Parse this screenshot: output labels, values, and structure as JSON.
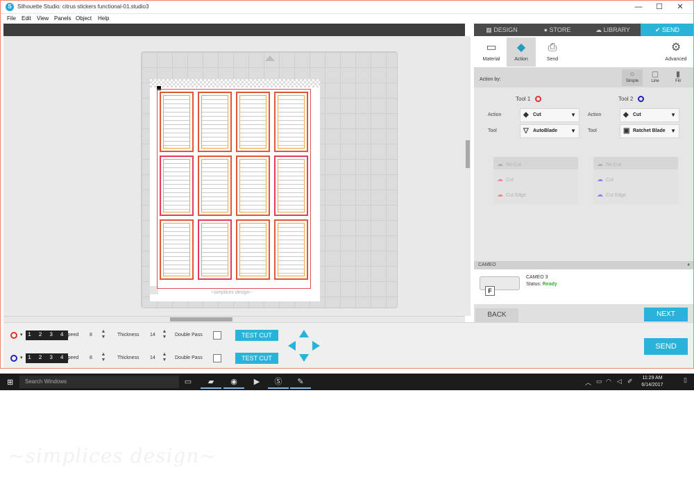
{
  "window": {
    "title": "Silhouette Studio: citrus stickers functional-01.studio3",
    "app_icon": "S",
    "minimize": "—",
    "maximize": "☐",
    "close": "✕"
  },
  "menu": [
    "File",
    "Edit",
    "View",
    "Panels",
    "Object",
    "Help"
  ],
  "panel_tabs": [
    {
      "label": "DESIGN",
      "icon": "grid-icon"
    },
    {
      "label": "STORE",
      "icon": "store-icon"
    },
    {
      "label": "LIBRARY",
      "icon": "cloud-icon"
    },
    {
      "label": "SEND",
      "icon": "check-circle-icon",
      "active": true
    }
  ],
  "send_tabs": [
    "Material",
    "Action",
    "Send",
    "Advanced"
  ],
  "action_by": {
    "label": "Action by:",
    "modes": [
      "Simple",
      "Line",
      "Fill"
    ]
  },
  "tools": [
    {
      "heading": "Tool 1",
      "ring_color": "#e03030",
      "action_label": "Action",
      "action_value": "Cut",
      "tool_label": "Tool",
      "tool_value": "AutoBlade",
      "options": [
        "No Cut",
        "Cut",
        "Cut Edge"
      ]
    },
    {
      "heading": "Tool 2",
      "ring_color": "#2020c0",
      "action_label": "Action",
      "action_value": "Cut",
      "tool_label": "Tool",
      "tool_value": "Ratchet Blade",
      "options": [
        "No Cut",
        "Cut",
        "Cut Edge"
      ]
    }
  ],
  "cameo": {
    "header": "CAMEO",
    "name": "CAMEO 3",
    "status_label": "Status:",
    "status_value": "Ready",
    "panel_letter": "F",
    "collapse": "⏸"
  },
  "buttons": {
    "back": "BACK",
    "next": "NEXT",
    "send": "SEND",
    "test_cut": "TEST CUT"
  },
  "bottom_rows": [
    {
      "digits": "1 2 3 4",
      "speed_label": "Speed",
      "speed": "8",
      "thickness_label": "Thickness",
      "thickness": "14",
      "double_pass_label": "Double Pass"
    },
    {
      "digits": "1 2 3 4",
      "speed_label": "Speed",
      "speed": "8",
      "thickness_label": "Thickness",
      "thickness": "14",
      "double_pass_label": "Double Pass"
    }
  ],
  "page": {
    "footer_text": "~simplices design~"
  },
  "taskbar": {
    "search_placeholder": "Search Windows",
    "time": "11:29 AM",
    "date": "6/14/2017"
  },
  "watermark": "~simplices design~",
  "colors": {
    "accent": "#2ab3d8",
    "ready": "#2db52d",
    "tool1": "#e03030",
    "tool2": "#2020c0",
    "sticker_orange": "#e0563a",
    "sticker_pink": "#e43a5c"
  }
}
